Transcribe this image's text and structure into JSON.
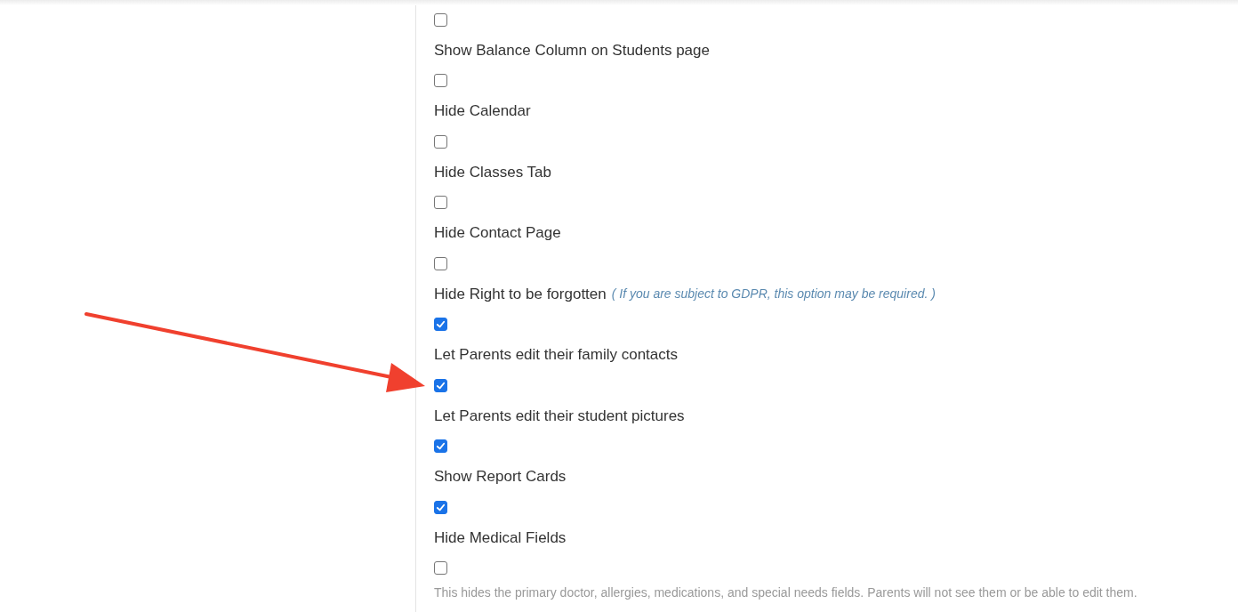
{
  "settings": [
    {
      "kind": "checkbox",
      "checked": false
    },
    {
      "kind": "label",
      "text": "Show Balance Column on Students page"
    },
    {
      "kind": "checkbox",
      "checked": false
    },
    {
      "kind": "label",
      "text": "Hide Calendar"
    },
    {
      "kind": "checkbox",
      "checked": false
    },
    {
      "kind": "label",
      "text": "Hide Classes Tab"
    },
    {
      "kind": "checkbox",
      "checked": false
    },
    {
      "kind": "label",
      "text": "Hide Contact Page"
    },
    {
      "kind": "checkbox",
      "checked": false
    },
    {
      "kind": "label",
      "text": "Hide Right to be forgotten",
      "note": "( If you are subject to GDPR, this option may be required. )"
    },
    {
      "kind": "checkbox",
      "checked": true
    },
    {
      "kind": "label",
      "text": "Let Parents edit their family contacts"
    },
    {
      "kind": "checkbox",
      "checked": true
    },
    {
      "kind": "label",
      "text": "Let Parents edit their student pictures"
    },
    {
      "kind": "checkbox",
      "checked": true
    },
    {
      "kind": "label",
      "text": "Show Report Cards"
    },
    {
      "kind": "checkbox",
      "checked": true
    },
    {
      "kind": "label",
      "text": "Hide Medical Fields"
    },
    {
      "kind": "checkbox",
      "checked": false
    },
    {
      "kind": "help",
      "text": "This hides the primary doctor, allergies, medications, and special needs fields. Parents will not see them or be able to edit them."
    }
  ]
}
